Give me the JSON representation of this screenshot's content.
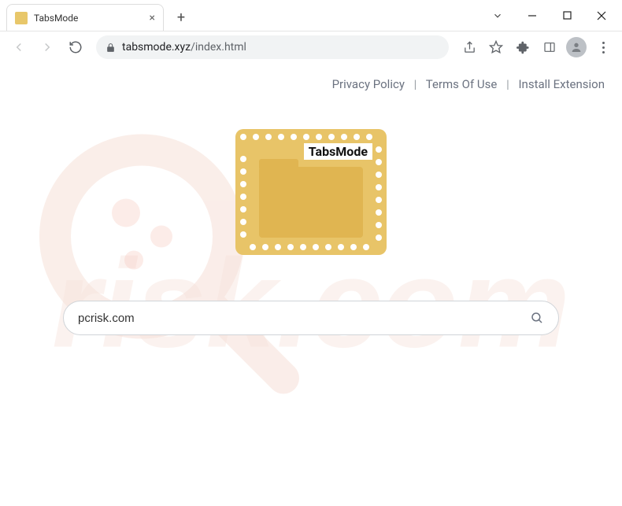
{
  "window": {
    "tab_title": "TabsMode",
    "url_domain": "tabsmode.xyz",
    "url_path": "/index.html"
  },
  "page": {
    "top_links": {
      "privacy": "Privacy Policy",
      "terms": "Terms Of Use",
      "install": "Install Extension"
    },
    "logo_label": "TabsMode",
    "search_value": "pcrisk.com"
  },
  "colors": {
    "logo_bg": "#e8c468",
    "logo_inner": "#e0b551"
  }
}
